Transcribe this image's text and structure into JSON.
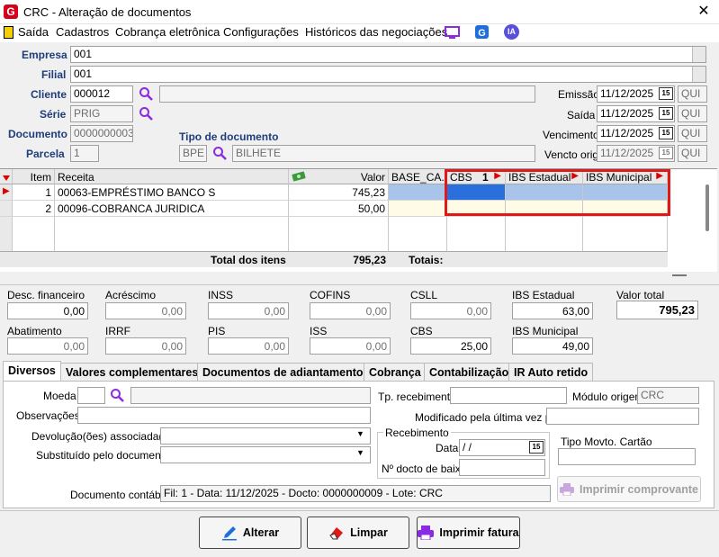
{
  "window": {
    "title": "CRC - Alteração de documentos",
    "close": "✕"
  },
  "menu": {
    "items": [
      "Saída",
      "Cadastros",
      "Cobrança eletrônica",
      "Configurações",
      "Históricos das negociações"
    ],
    "ia": "IA"
  },
  "header": {
    "empresa": {
      "label": "Empresa",
      "code": "001",
      "name": ""
    },
    "filial": {
      "label": "Filial",
      "code": "001",
      "name": ""
    },
    "cliente": {
      "label": "Cliente",
      "code": "000012",
      "name": ""
    },
    "serie": {
      "label": "Série",
      "value": "PRIG"
    },
    "documento": {
      "label": "Documento",
      "value": "0000000003"
    },
    "parcela": {
      "label": "Parcela",
      "value": "1"
    },
    "tipo_documento": {
      "label": "Tipo de documento",
      "code": "BPE",
      "name": "BILHETE"
    },
    "emissao": {
      "label": "Emissão",
      "date": "11/12/2025",
      "day": "QUI"
    },
    "saida": {
      "label": "Saída",
      "date": "11/12/2025",
      "day": "QUI"
    },
    "vencimento": {
      "label": "Vencimento",
      "date": "11/12/2025",
      "day": "QUI"
    },
    "vencto_orig": {
      "label": "Vencto orig",
      "date": "11/12/2025",
      "day": "QUI"
    },
    "cal_glyph": "15"
  },
  "grid": {
    "columns": {
      "item": "Item",
      "receita": "Receita",
      "valor": "Valor",
      "base": "BASE_CA...",
      "cbs": "CBS",
      "cbs_sort": "1",
      "ibs_est": "IBS Estadual",
      "ibs_mun": "IBS Municipal"
    },
    "rows": [
      {
        "item": "1",
        "receita": "00063-EMPRÉSTIMO BANCO S",
        "valor": "745,23"
      },
      {
        "item": "2",
        "receita": "00096-COBRANCA JURIDICA",
        "valor": "50,00"
      }
    ],
    "total_label": "Total dos itens",
    "total_value": "795,23",
    "totais": "Totais:"
  },
  "values": {
    "desc_fin": {
      "label": "Desc. financeiro",
      "value": "0,00"
    },
    "acrescimo": {
      "label": "Acréscimo",
      "value": "0,00"
    },
    "inss": {
      "label": "INSS",
      "value": "0,00"
    },
    "cofins": {
      "label": "COFINS",
      "value": "0,00"
    },
    "csll": {
      "label": "CSLL",
      "value": "0,00"
    },
    "ibs_estadual": {
      "label": "IBS Estadual",
      "value": "63,00"
    },
    "valor_total": {
      "label": "Valor total",
      "value": "795,23"
    },
    "abatimento": {
      "label": "Abatimento",
      "value": "0,00"
    },
    "irrf": {
      "label": "IRRF",
      "value": "0,00"
    },
    "pis": {
      "label": "PIS",
      "value": "0,00"
    },
    "iss": {
      "label": "ISS",
      "value": "0,00"
    },
    "cbs": {
      "label": "CBS",
      "value": "25,00"
    },
    "ibs_municipal": {
      "label": "IBS Municipal",
      "value": "49,00"
    }
  },
  "tabs": [
    "Diversos",
    "Valores complementares",
    "Documentos de adiantamento",
    "Cobrança",
    "Contabilização",
    "IR Auto retido"
  ],
  "diversos": {
    "moeda": "Moeda",
    "observacoes": "Observações",
    "devolucoes": "Devolução(ões) associada(s)",
    "substituido": "Substituído pelo documento",
    "tp_recebimento": "Tp. recebimento",
    "modulo_origem": "Módulo origem",
    "modulo_value": "CRC",
    "modificado": "Modificado pela última vez por",
    "recebimento": "Recebimento",
    "data": "Data",
    "data_value": " /  /",
    "no_docto": "Nº docto de baixa",
    "tipo_movto": "Tipo Movto. Cartão",
    "imprimir_comprovante": "Imprimir comprovante",
    "doc_contabil": "Documento contábil",
    "doc_contabil_value": "Fil: 1 - Data: 11/12/2025 - Docto: 0000000009 - Lote: CRC"
  },
  "buttons": {
    "alterar": "Alterar",
    "limpar": "Limpar",
    "imprimir": "Imprimir fatura"
  }
}
